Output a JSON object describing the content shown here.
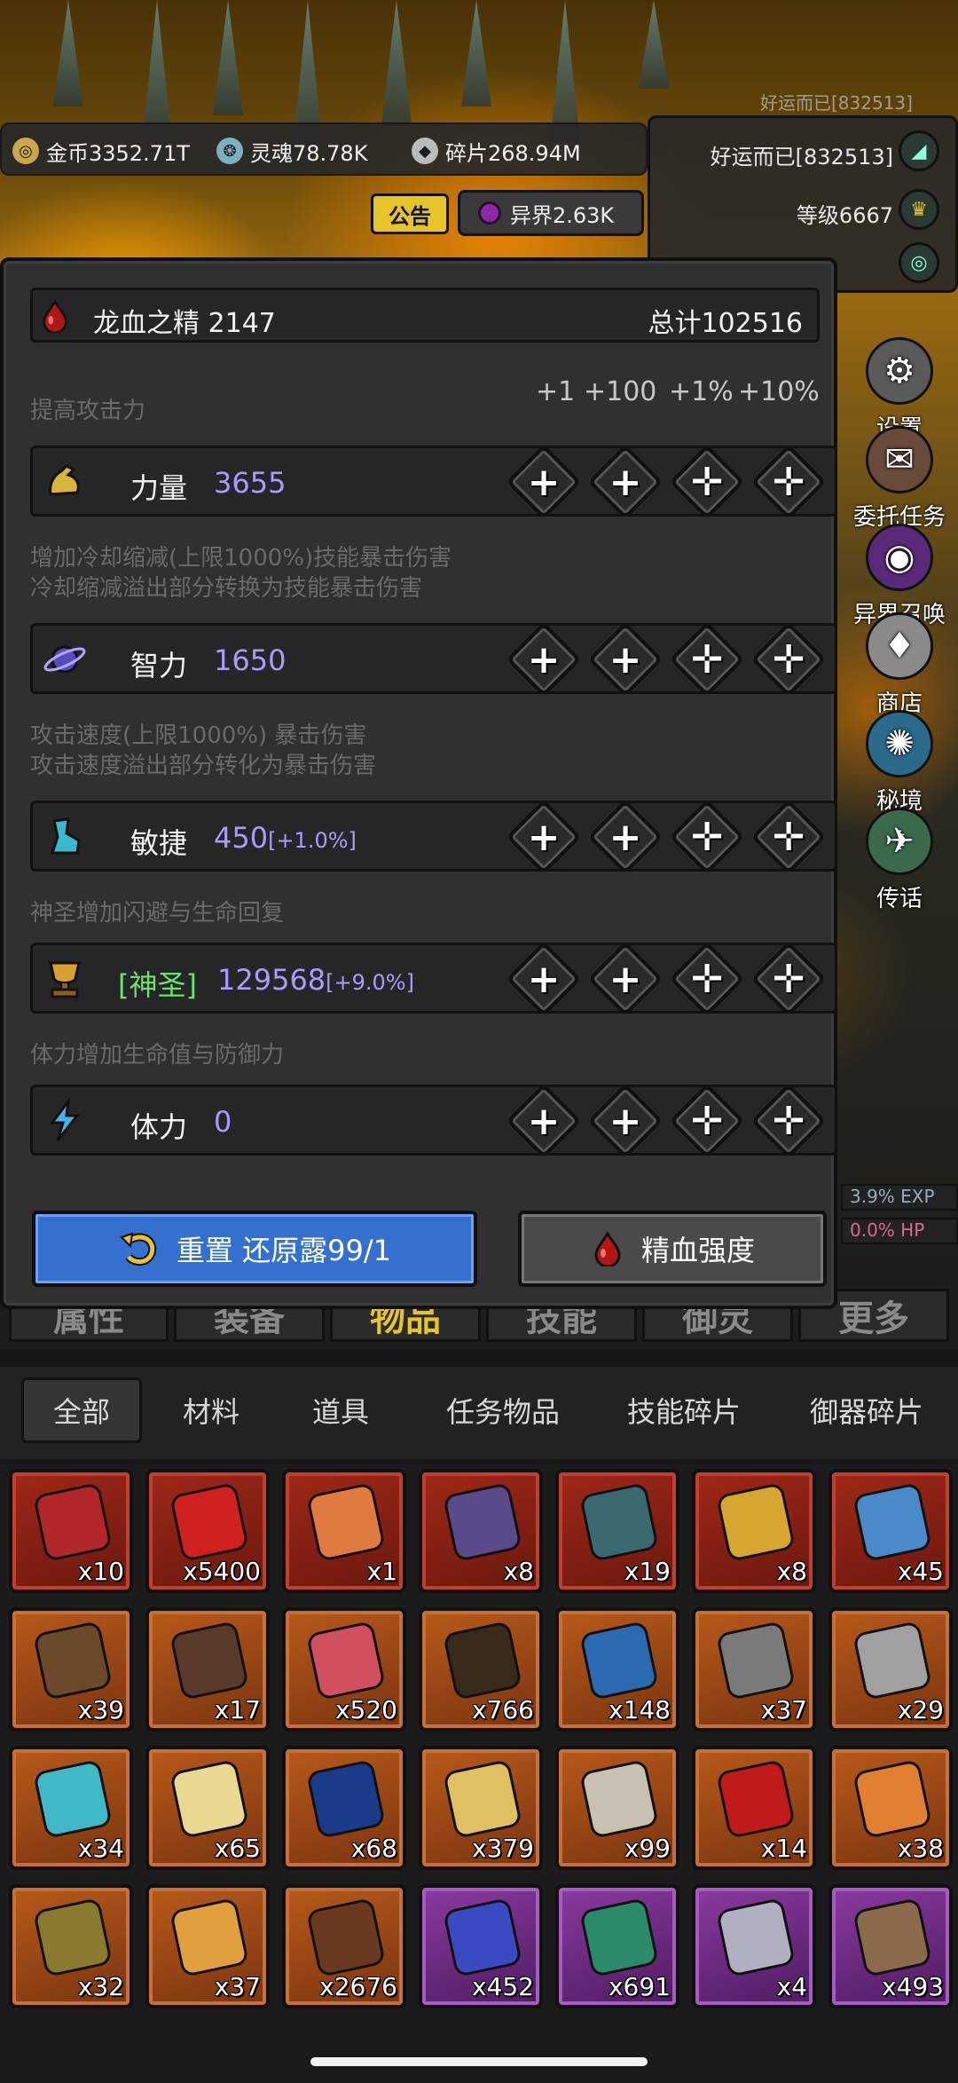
{
  "colors": {
    "accent_gold": "#e6c42a",
    "stat_value": "#a99cff",
    "holy_green": "#6ee06e",
    "reset_blue": "#3570d0"
  },
  "hud": {
    "top_name": "好运而已[832513]",
    "gold": "金币3352.71T",
    "soul": "灵魂78.78K",
    "shard": "碎片268.94M",
    "notice_label": "公告",
    "otherworld": "异界2.63K",
    "player_name": "好运而已[832513]",
    "level": "等级6667"
  },
  "side_menu": {
    "settings": "设置",
    "commission": "委托任务",
    "summon": "异界召唤",
    "shop": "商店",
    "secret": "秘境",
    "teleport": "传话"
  },
  "bars": {
    "exp": "3.9% EXP",
    "hp": "0.0% HP"
  },
  "main_tabs": [
    "属性",
    "装备",
    "物品",
    "技能",
    "御灵",
    "更多"
  ],
  "dialog": {
    "essence_name": "龙血之精 2147",
    "total": "总计102516",
    "increments": [
      "+1",
      "+100",
      "+1%",
      "+10%"
    ],
    "stats": [
      {
        "desc": "提高攻击力",
        "label": "力量",
        "value": "3655",
        "bonus": "",
        "icon": "strength-arm-icon"
      },
      {
        "desc": "增加冷却缩减(上限1000%)技能暴击伤害\n冷却缩减溢出部分转换为技能暴击伤害",
        "label": "智力",
        "value": "1650",
        "bonus": "",
        "icon": "intelligence-orb-icon"
      },
      {
        "desc": "攻击速度(上限1000%) 暴击伤害\n攻击速度溢出部分转化为暴击伤害",
        "label": "敏捷",
        "value": "450",
        "bonus": "[+1.0%]",
        "icon": "agility-boot-icon"
      },
      {
        "desc": "神圣增加闪避与生命回复",
        "label": "[神圣]",
        "value": "129568",
        "bonus": "[+9.0%]",
        "icon": "holy-trophy-icon"
      },
      {
        "desc": "体力增加生命值与防御力",
        "label": "体力",
        "value": "0",
        "bonus": "",
        "icon": "stamina-bolt-icon"
      }
    ],
    "reset_label": "重置 还原露99/1",
    "essence_label": "精血强度"
  },
  "filters": [
    "全部",
    "材料",
    "道具",
    "任务物品",
    "技能碎片",
    "御器碎片"
  ],
  "items": [
    {
      "count": "x10",
      "frame": "red",
      "color": "#b3262a",
      "icon": "blood-gem-icon"
    },
    {
      "count": "x5400",
      "frame": "red",
      "color": "#d02020",
      "icon": "red-swirl-icon"
    },
    {
      "count": "x1",
      "frame": "red",
      "color": "#e07a40",
      "icon": "fire-crystal-icon"
    },
    {
      "count": "x8",
      "frame": "red",
      "color": "#5a4a8a",
      "icon": "rune-stone-icon"
    },
    {
      "count": "x19",
      "frame": "red",
      "color": "#3a6a70",
      "icon": "chain-icon"
    },
    {
      "count": "x8",
      "frame": "red",
      "color": "#d8a630",
      "icon": "golden-key-icon"
    },
    {
      "count": "x45",
      "frame": "red",
      "color": "#4a8ac8",
      "icon": "shuriken-icon"
    },
    {
      "count": "x39",
      "frame": "orange",
      "color": "#6a4a2a",
      "icon": "spear-icon"
    },
    {
      "count": "x17",
      "frame": "orange",
      "color": "#5a3a2a",
      "icon": "necklace-icon"
    },
    {
      "count": "x520",
      "frame": "orange",
      "color": "#d05060",
      "icon": "pink-crystal-icon"
    },
    {
      "count": "x766",
      "frame": "orange",
      "color": "#3a2a1a",
      "icon": "dark-ring-icon"
    },
    {
      "count": "x148",
      "frame": "orange",
      "color": "#2a6ab0",
      "icon": "blue-drop-icon"
    },
    {
      "count": "x37",
      "frame": "orange",
      "color": "#7a7a7a",
      "icon": "dagger-icon"
    },
    {
      "count": "x29",
      "frame": "orange",
      "color": "#a0a0a0",
      "icon": "horn-icon"
    },
    {
      "count": "x34",
      "frame": "orange",
      "color": "#40b8c8",
      "icon": "cyan-shard-icon"
    },
    {
      "count": "x65",
      "frame": "orange",
      "color": "#e8d890",
      "icon": "yellow-crystal-icon"
    },
    {
      "count": "x68",
      "frame": "orange",
      "color": "#1a3a8a",
      "icon": "blue-scale-icon"
    },
    {
      "count": "x379",
      "frame": "orange",
      "color": "#e0c060",
      "icon": "hourglass-icon"
    },
    {
      "count": "x99",
      "frame": "orange",
      "color": "#c8c0b0",
      "icon": "bone-icon"
    },
    {
      "count": "x14",
      "frame": "orange",
      "color": "#c01a1a",
      "icon": "ruby-icon"
    },
    {
      "count": "x38",
      "frame": "orange",
      "color": "#e08030",
      "icon": "amber-icon"
    },
    {
      "count": "x32",
      "frame": "orange",
      "color": "#8a7a30",
      "icon": "gold-ingot-icon"
    },
    {
      "count": "x37",
      "frame": "orange",
      "color": "#e0a040",
      "icon": "scroll-icon"
    },
    {
      "count": "x2676",
      "frame": "orange",
      "color": "#6a3a20",
      "icon": "hook-icon"
    },
    {
      "count": "x452",
      "frame": "purple",
      "color": "#3a4ac0",
      "icon": "blue-spike-icon"
    },
    {
      "count": "x691",
      "frame": "purple",
      "color": "#2a8a6a",
      "icon": "green-ore-icon"
    },
    {
      "count": "x4",
      "frame": "purple",
      "color": "#b0b0c0",
      "icon": "sword-icon"
    },
    {
      "count": "x493",
      "frame": "purple",
      "color": "#8a6a4a",
      "icon": "rock-icon"
    }
  ]
}
